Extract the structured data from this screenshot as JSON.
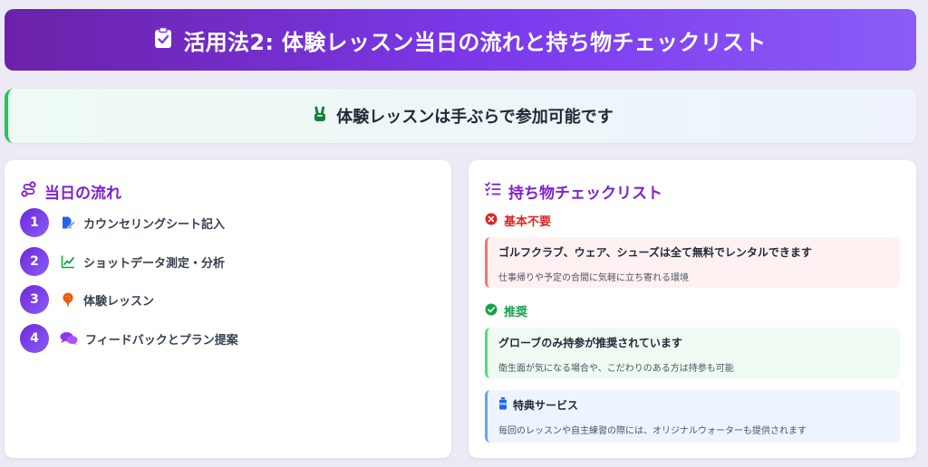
{
  "header": {
    "icon": "clipboard-check-icon",
    "title": "活用法2: 体験レッスン当日の流れと持ち物チェックリスト"
  },
  "banner": {
    "icon": "hand-peace-icon",
    "text": "体験レッスンは手ぶらで参加可能です"
  },
  "flow": {
    "title": "当日の流れ",
    "icon": "route-icon",
    "steps": [
      {
        "num": "1",
        "label": "カウンセリングシート記入",
        "icon": "file-pen-icon"
      },
      {
        "num": "2",
        "label": "ショットデータ測定・分析",
        "icon": "chart-line-icon"
      },
      {
        "num": "3",
        "label": "体験レッスン",
        "icon": "golf-ball-tee-icon"
      },
      {
        "num": "4",
        "label": "フィードバックとプラン提案",
        "icon": "comments-icon"
      }
    ]
  },
  "checklist": {
    "title": "持ち物チェックリスト",
    "icon": "list-check-icon",
    "not_needed": {
      "heading": "基本不要",
      "main": "ゴルフクラブ、ウェア、シューズは全て無料でレンタルできます",
      "sub": "仕事帰りや予定の合間に気軽に立ち寄れる環境"
    },
    "recommended": {
      "heading": "推奨",
      "main": "グローブのみ持参が推奨されています",
      "sub": "衛生面が気になる場合や、こだわりのある方は持参も可能"
    },
    "perk": {
      "heading": "特典サービス",
      "sub": "毎回のレッスンや自主練習の際には、オリジナルウォーターも提供されます"
    }
  },
  "colors": {
    "accent": "#7e22ce",
    "header_start": "#6b21a8",
    "header_end": "#8b5cf6",
    "danger": "#dc2626",
    "success": "#16a34a",
    "info": "#2563eb"
  }
}
